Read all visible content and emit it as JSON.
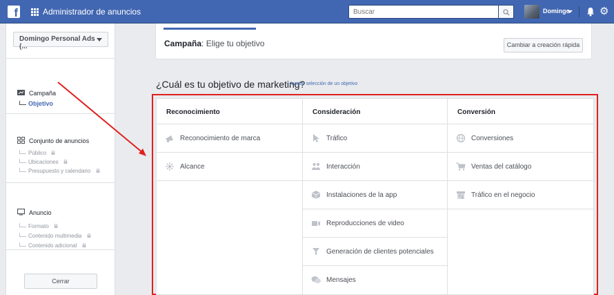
{
  "topbar": {
    "logo": "f",
    "app_title": "Administrador de anuncios",
    "search_placeholder": "Buscar",
    "user_name": "Domingo",
    "icons": [
      "facebook-logo-icon",
      "grid-menu-icon",
      "search-icon",
      "notifications-bell-icon",
      "settings-gear-icon"
    ]
  },
  "sidebar": {
    "account": "Domingo Personal Ads (...",
    "sections": [
      {
        "title": "Campaña",
        "items": [
          {
            "label": "Objetivo",
            "active": true
          }
        ]
      },
      {
        "title": "Conjunto de anuncios",
        "items": [
          {
            "label": "Público",
            "locked": true
          },
          {
            "label": "Ubicaciones",
            "locked": true
          },
          {
            "label": "Presupuesto y calendario",
            "locked": true
          }
        ]
      },
      {
        "title": "Anuncio",
        "items": [
          {
            "label": "Formato",
            "locked": true
          },
          {
            "label": "Contenido multimedia",
            "locked": true
          },
          {
            "label": "Contenido adicional",
            "locked": true
          }
        ]
      }
    ],
    "close_label": "Cerrar"
  },
  "campaign": {
    "title_bold": "Campaña",
    "title_rest": ": Elige tu objetivo",
    "quick_label": "Cambiar a creación rápida"
  },
  "question": "¿Cuál es tu objetivo de marketing?",
  "help_link": "Ayuda: selección de un objetivo",
  "columns": [
    {
      "header": "Reconocimiento",
      "items": [
        {
          "label": "Reconocimiento de marca",
          "icon": "megaphone-icon"
        },
        {
          "label": "Alcance",
          "icon": "reach-burst-icon"
        }
      ]
    },
    {
      "header": "Consideración",
      "items": [
        {
          "label": "Tráfico",
          "icon": "cursor-icon"
        },
        {
          "label": "Interacción",
          "icon": "people-icon"
        },
        {
          "label": "Instalaciones de la app",
          "icon": "app-box-icon"
        },
        {
          "label": "Reproducciones de video",
          "icon": "video-camera-icon"
        },
        {
          "label": "Generación de clientes potenciales",
          "icon": "funnel-icon"
        },
        {
          "label": "Mensajes",
          "icon": "chat-bubbles-icon"
        }
      ]
    },
    {
      "header": "Conversión",
      "items": [
        {
          "label": "Conversiones",
          "icon": "globe-icon"
        },
        {
          "label": "Ventas del catálogo",
          "icon": "shopping-cart-icon"
        },
        {
          "label": "Tráfico en el negocio",
          "icon": "store-icon"
        }
      ]
    }
  ],
  "colors": {
    "topbar": "#4267b2",
    "link": "#4267b2",
    "highlight": "#e0201e",
    "icon_gray": "#bec2c9"
  }
}
